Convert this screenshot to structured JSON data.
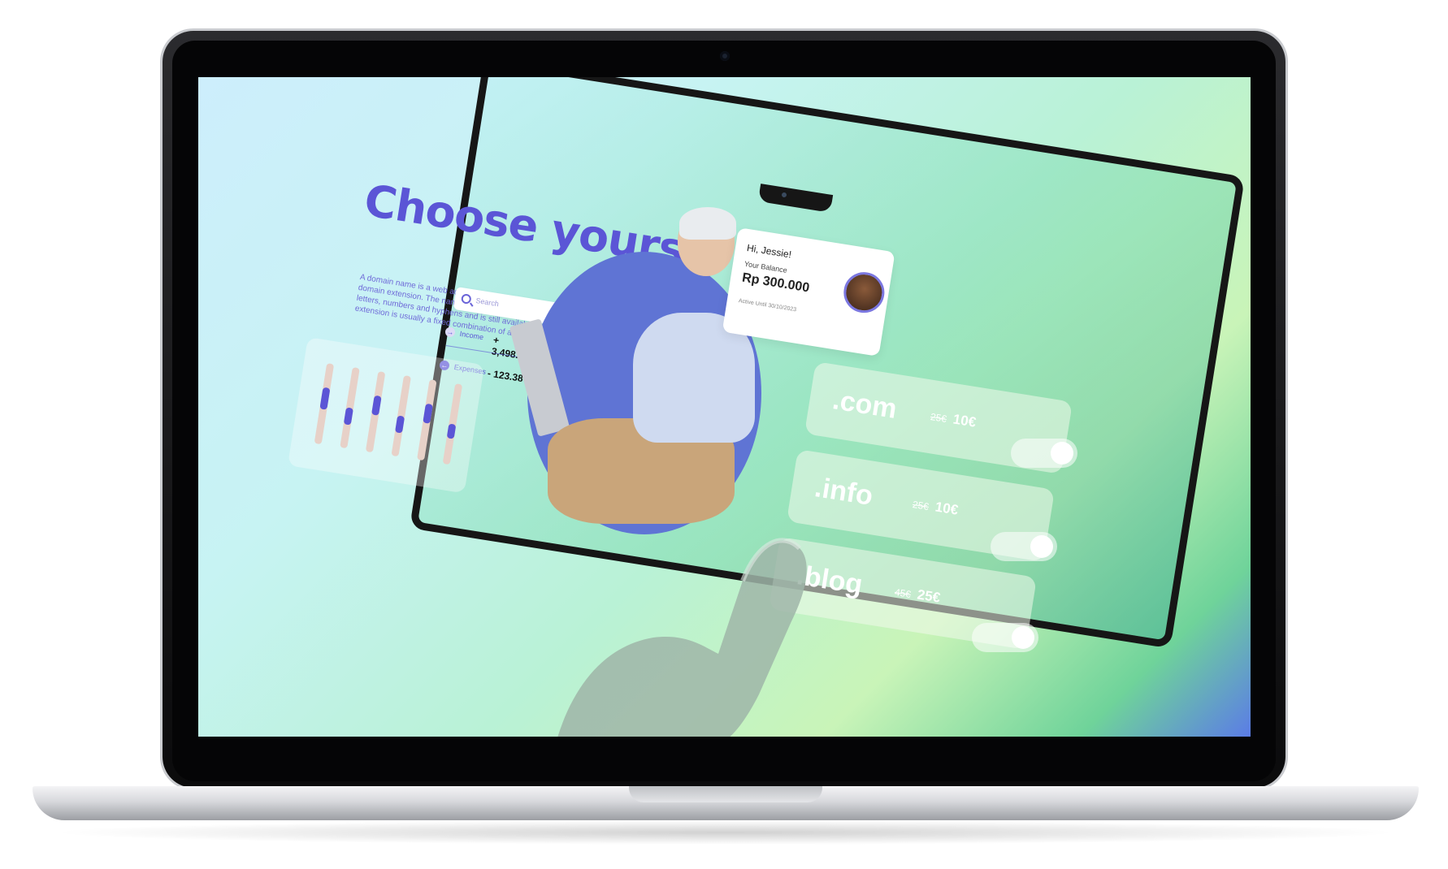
{
  "device": "laptop",
  "hero": {
    "title": "Choose yours",
    "description": "A domain name is a web address made up of a website name and a domain extension. The name is up to you, as long as it is made up of letters, numbers and hyphens and is still available, while the domain extension is usually a fixed combination of a few letters."
  },
  "search": {
    "placeholder": "Search"
  },
  "finance": {
    "income_label": "Income",
    "income_value": "+ 3,498.21",
    "expenses_label": "Expenses",
    "expenses_value": "- 123.38"
  },
  "chart_data": {
    "type": "bar",
    "categories": [
      "",
      "",
      "",
      "",
      "",
      ""
    ],
    "values": [
      0.45,
      0.35,
      0.4,
      0.35,
      0.4,
      0.3
    ],
    "title": ""
  },
  "balance": {
    "greeting": "Hi, Jessie!",
    "label": "Your Balance",
    "value": "Rp 300.000",
    "active_until": "Active Until 30/10/2023"
  },
  "domains": [
    {
      "name": ".com",
      "old_price": "25€",
      "new_price": "10€",
      "enabled": true
    },
    {
      "name": ".info",
      "old_price": "25€",
      "new_price": "10€",
      "enabled": true
    },
    {
      "name": ".blog",
      "old_price": "45€",
      "new_price": "25€",
      "enabled": true
    }
  ],
  "colors": {
    "accent": "#5b55d6",
    "circle": "#5f74d4"
  }
}
